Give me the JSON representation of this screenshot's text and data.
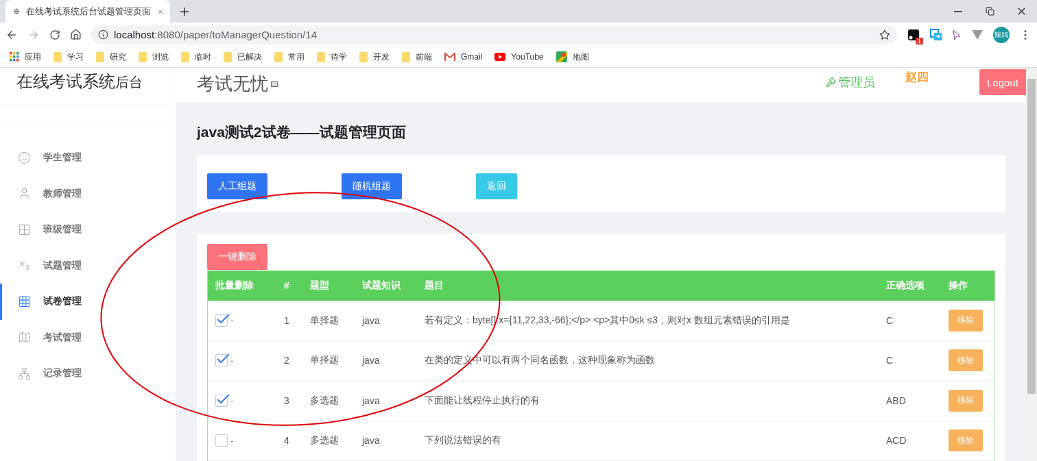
{
  "browser": {
    "tab_title": "在线考试系统后台试题管理页面",
    "url_host": "localhost",
    "url_path": ":8080/paper/toManagerQuestion/14",
    "extension_badge": "1",
    "profile": "辣鸡",
    "bookmarks": [
      {
        "kind": "apps",
        "label": "应用"
      },
      {
        "kind": "folder",
        "label": "学习"
      },
      {
        "kind": "folder",
        "label": "研究"
      },
      {
        "kind": "folder",
        "label": "浏览"
      },
      {
        "kind": "folder",
        "label": "临时"
      },
      {
        "kind": "folder",
        "label": "已解决"
      },
      {
        "kind": "folder",
        "label": "常用"
      },
      {
        "kind": "folder",
        "label": "待学"
      },
      {
        "kind": "folder",
        "label": "开发"
      },
      {
        "kind": "folder",
        "label": "前端"
      },
      {
        "kind": "gmail",
        "label": "Gmail"
      },
      {
        "kind": "youtube",
        "label": "YouTube"
      },
      {
        "kind": "maps",
        "label": "地图"
      }
    ]
  },
  "sidebar": {
    "brand": "在线考试系统",
    "brand_suffix": "后台",
    "items": [
      {
        "kind": "student",
        "label": "学生管理",
        "selected": false
      },
      {
        "kind": "teacher",
        "label": "教师管理",
        "selected": false
      },
      {
        "kind": "class",
        "label": "班级管理",
        "selected": false
      },
      {
        "kind": "question",
        "label": "试题管理",
        "selected": false
      },
      {
        "kind": "paper",
        "label": "试卷管理",
        "selected": true
      },
      {
        "kind": "exam",
        "label": "考试管理",
        "selected": false
      },
      {
        "kind": "record",
        "label": "记录管理",
        "selected": false
      }
    ]
  },
  "header": {
    "title": "考试无忧",
    "role": "管理员",
    "user": "赵四",
    "logout": "Logout"
  },
  "page_title": "java测试2试卷——试题管理页面",
  "actions": [
    {
      "kind": "primary",
      "label": "人工组题"
    },
    {
      "kind": "primary",
      "label": "随机组题"
    },
    {
      "kind": "info",
      "label": "返回"
    }
  ],
  "delete_all": "一键删除",
  "table": {
    "columns": [
      "批量删除",
      "#",
      "题型",
      "试题知识",
      "题目",
      "正确选项",
      "操作"
    ],
    "rows": [
      {
        "checked": true,
        "mark": "-",
        "no": "1",
        "type": "单择题",
        "topic": "java",
        "question": "若有定义：byte[] x={11,22,33,-66};</p> <p>其中0≤k ≤3，则对x 数组元素错误的引用是",
        "answer": "C",
        "action": "移除"
      },
      {
        "checked": true,
        "mark": "-",
        "no": "2",
        "type": "单择题",
        "topic": "java",
        "question": "在类的定义中可以有两个同名函数，这种现象称为函数",
        "answer": "C",
        "action": "移除"
      },
      {
        "checked": true,
        "mark": "-",
        "no": "3",
        "type": "多选题",
        "topic": "java",
        "question": "下面能让线程停止执行的有",
        "answer": "ABD",
        "action": "移除"
      },
      {
        "checked": false,
        "mark": "-",
        "no": "4",
        "type": "多选题",
        "topic": "java",
        "question": "下列说法错误的有",
        "answer": "ACD",
        "action": "移除"
      }
    ]
  },
  "annotations": [
    {
      "kind": "ellipse",
      "color": "#e00000"
    }
  ]
}
